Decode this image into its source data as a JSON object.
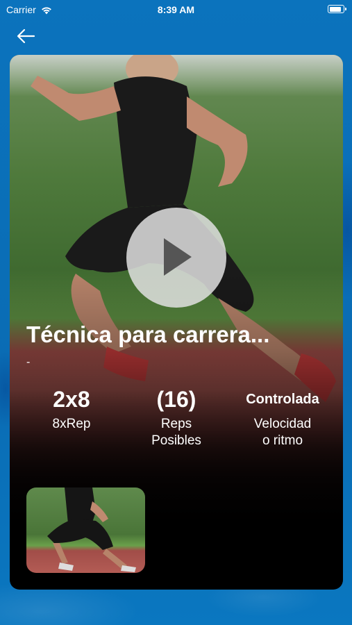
{
  "status_bar": {
    "carrier": "Carrier",
    "time": "8:39 AM",
    "battery_level": 0.9
  },
  "nav": {
    "back_icon": "arrow-left-icon"
  },
  "exercise": {
    "title": "Técnica para carrera...",
    "subtitle": "-",
    "play_icon": "play-icon",
    "stats": [
      {
        "value": "2x8",
        "label_line1": "8xRep",
        "label_line2": ""
      },
      {
        "value": "(16)",
        "label_line1": "Reps",
        "label_line2": "Posibles"
      },
      {
        "value": "Controlada",
        "label_line1": "Velocidad",
        "label_line2": "o ritmo"
      }
    ]
  },
  "colors": {
    "background": "#0a6fb8",
    "card_background": "#000000",
    "text": "#ffffff"
  }
}
